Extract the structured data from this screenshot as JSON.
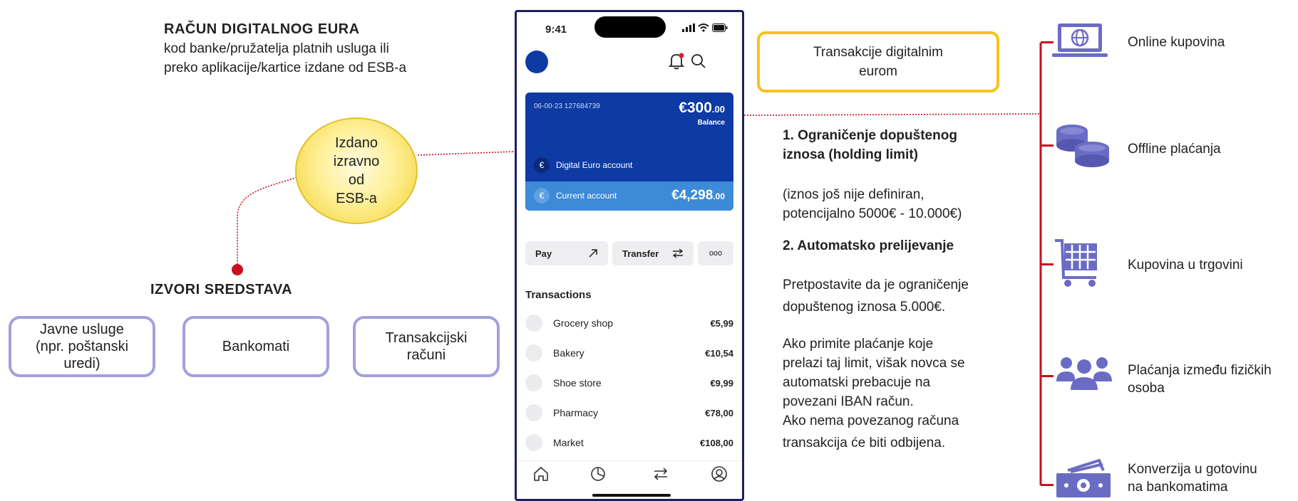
{
  "account_heading": "RAČUN DIGITALNOG EURA",
  "account_desc_line1": "kod banke/pružatelja platnih usluga ili",
  "account_desc_line2": "preko aplikacije/kartice izdane od ESB-a",
  "issued": {
    "line1": "Izdano",
    "line2": "izravno",
    "line3": "od",
    "line4": "ESB-a"
  },
  "sources": {
    "heading": "IZVORI SREDSTAVA",
    "items": [
      {
        "line1": "Javne usluge",
        "line2": "(npr. poštanski",
        "line3": "uredi)"
      },
      {
        "line1": "Bankomati"
      },
      {
        "line1": "Transakcijski",
        "line2": "računi"
      }
    ]
  },
  "phone": {
    "time": "9:41",
    "card": {
      "account_meta": "06-00-23  127684739",
      "balance_main": "€300",
      "balance_cents": ".00",
      "balance_label": "Balance",
      "digital_label": "Digital Euro account",
      "current_label": "Current account",
      "current_main": "€4,298",
      "current_cents": ".00",
      "euro_symbol": "€"
    },
    "actions": [
      {
        "label": "Pay",
        "icon": "arrow-up-right-icon"
      },
      {
        "label": "Transfer",
        "icon": "swap-arrows-icon"
      },
      {
        "label": "ooo",
        "icon": "more-icon"
      }
    ],
    "transactions_title": "Transactions",
    "transactions": [
      {
        "name": "Grocery shop",
        "amount": "€5,99"
      },
      {
        "name": "Bakery",
        "amount": "€10,54"
      },
      {
        "name": "Shoe store",
        "amount": "€9,99"
      },
      {
        "name": "Pharmacy",
        "amount": "€78,00"
      },
      {
        "name": "Market",
        "amount": "€108,00"
      }
    ],
    "nav_icons": [
      "home-icon",
      "chart-icon",
      "transfer-icon",
      "profile-icon"
    ]
  },
  "transactions_box": {
    "line1": "Transakcije digitalnim",
    "line2": "eurom"
  },
  "limit": {
    "heading_line1": "1. Ograničenje dopuštenog",
    "heading_line2": "iznosa (holding limit)",
    "note_line1": "(iznos još nije definiran,",
    "note_line2": "potencijalno 5000€ - 10.000€)"
  },
  "overflow": {
    "heading": "2. Automatsko prelijevanje",
    "p1_line1": "Pretpostavite da je ograničenje",
    "p1_line2": "dopuštenog iznosa 5.000€.",
    "p2_line1": "Ako primite plaćanje koje",
    "p2_line2": "prelazi taj limit, višak novca se",
    "p2_line3": "automatski prebacuje na",
    "p2_line4": "povezani IBAN račun.",
    "p2_line5": "Ako nema povezanog računa",
    "p2_line6": "transakcija će biti odbijena."
  },
  "uses": [
    {
      "label_line1": "Online kupovina",
      "icon": "laptop-globe-icon"
    },
    {
      "label_line1": "Offline plaćanja",
      "icon": "coins-icon"
    },
    {
      "label_line1": "Kupovina u trgovini",
      "icon": "shopping-cart-icon"
    },
    {
      "label_line1": "Plaćanja između fizičkih",
      "label_line2": "osoba",
      "icon": "people-icon"
    },
    {
      "label_line1": "Konverzija u gotovinu",
      "label_line2": "na bankomatima",
      "icon": "cash-icon"
    }
  ],
  "colors": {
    "card_blue": "#0d3aa3",
    "card_light_blue": "#3d8ad6",
    "accent_red": "#c81020",
    "icon_purple": "#6a6cc4",
    "box_border": "#a3a0de",
    "highlight_yellow": "#f7c21f"
  }
}
